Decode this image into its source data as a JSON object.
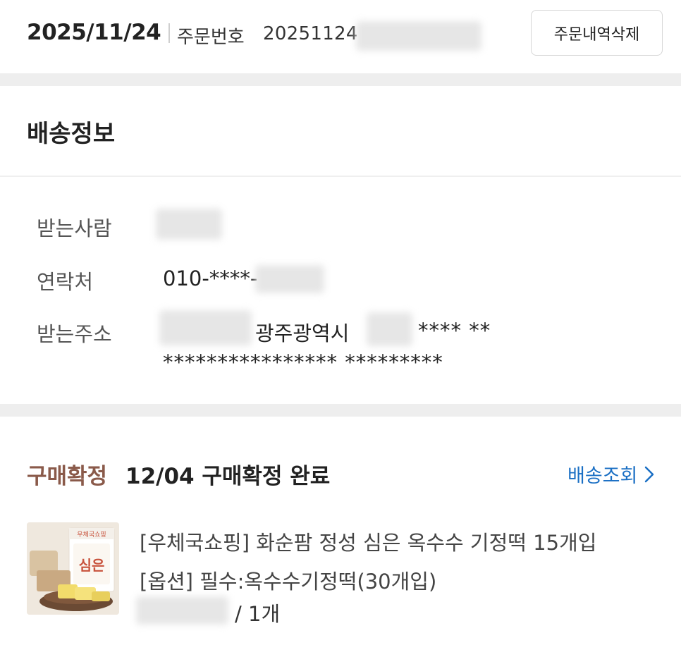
{
  "header": {
    "date": "2025/11/24",
    "order_label": "주문번호",
    "order_number_visible": "20251124",
    "delete_button": "주문내역삭제"
  },
  "shipping": {
    "title": "배송정보",
    "recipient_label": "받는사람",
    "contact_label": "연락처",
    "contact_value_visible": "010-****-",
    "address_label": "받는주소",
    "address_city": "광주광역시",
    "address_mask_1": "**** **",
    "address_mask_2": "**************** *********"
  },
  "purchase": {
    "status_label": "구매확정",
    "status_text": "12/04 구매확정 완료",
    "track_link": "배송조회",
    "product_name": "[우체국쇼핑] 화순팜 정성 심은 옥수수 기정떡 15개입",
    "product_option": "[옵션] 필수:옥수수기정떡(30개입)",
    "quantity": "/ 1개",
    "thumbnail_brand_text": "심은",
    "thumbnail_top_text": "우체국쇼핑"
  },
  "colors": {
    "status_brown": "#8a5a4a",
    "link_blue": "#1a6fc4",
    "section_gap": "#eeeeee"
  }
}
